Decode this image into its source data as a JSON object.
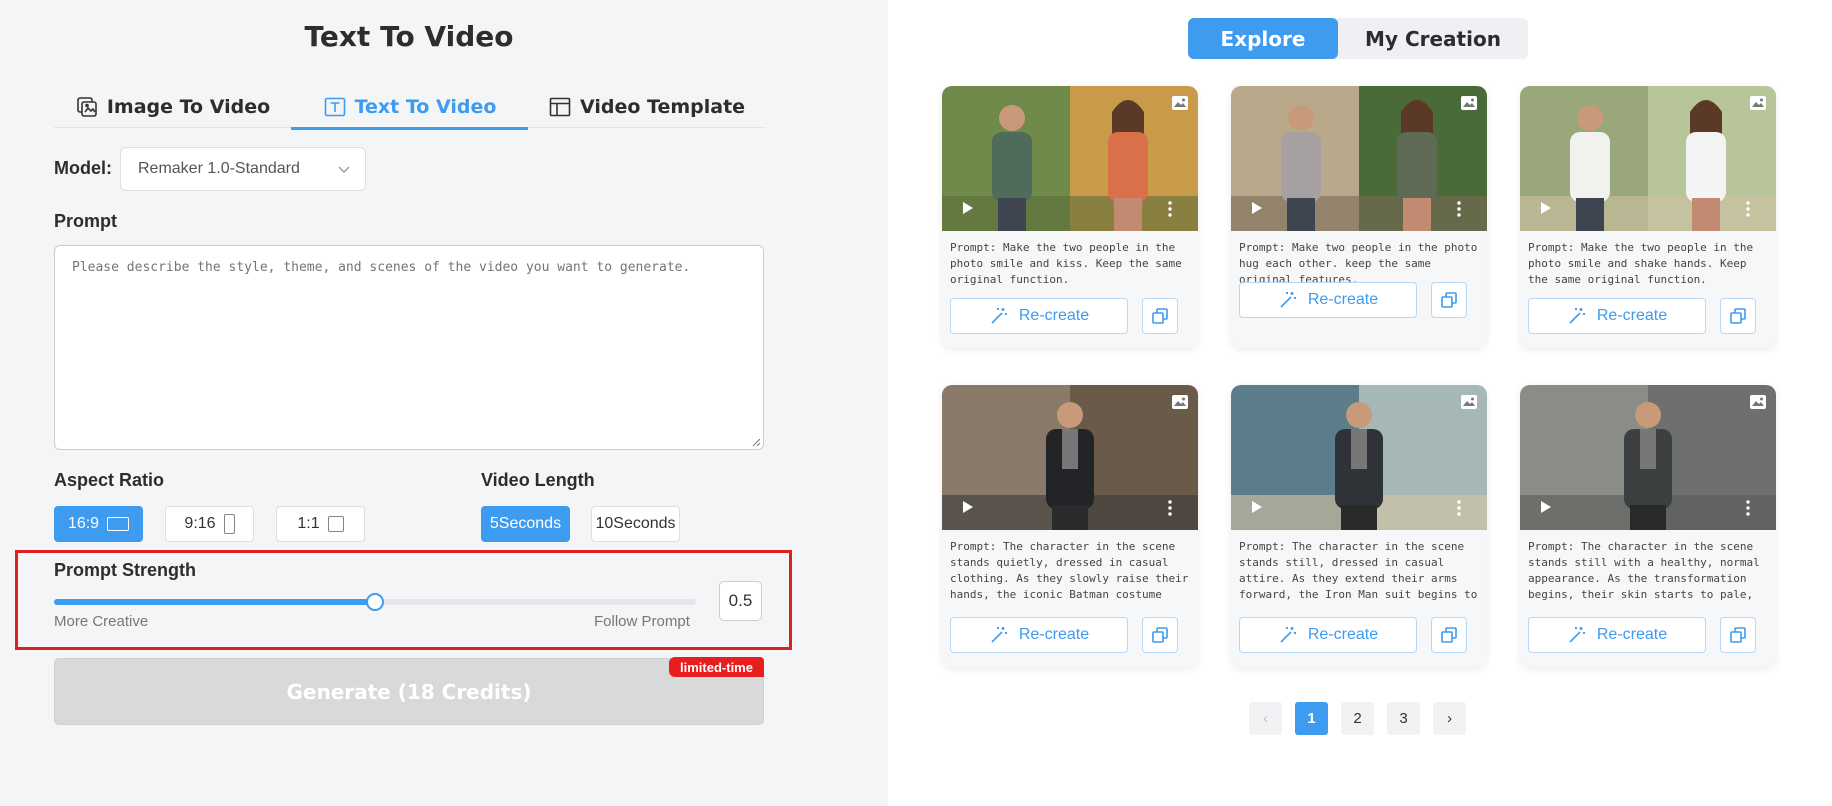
{
  "left": {
    "title": "Text To Video",
    "tabs": [
      {
        "label": "Image To Video",
        "icon": "image-to-video-icon"
      },
      {
        "label": "Text To Video",
        "icon": "text-icon",
        "active": true
      },
      {
        "label": "Video Template",
        "icon": "template-icon"
      }
    ],
    "model": {
      "label": "Model:",
      "value": "Remaker 1.0-Standard"
    },
    "prompt": {
      "label": "Prompt",
      "placeholder": "Please describe the style, theme, and scenes of the video you want to generate."
    },
    "aspect_ratio": {
      "label": "Aspect Ratio",
      "options": [
        {
          "label": "16:9",
          "active": true
        },
        {
          "label": "9:16"
        },
        {
          "label": "1:1"
        }
      ]
    },
    "video_length": {
      "label": "Video Length",
      "options": [
        {
          "label": "5Seconds",
          "active": true
        },
        {
          "label": "10Seconds"
        }
      ]
    },
    "prompt_strength": {
      "label": "Prompt Strength",
      "min_label": "More Creative",
      "max_label": "Follow Prompt",
      "value_text": "0.5",
      "value": 0.5
    },
    "generate": {
      "label": "Generate (18 Credits)",
      "badge": "limited-time"
    }
  },
  "right": {
    "switch": {
      "explore": "Explore",
      "my_creation": "My Creation"
    },
    "recreate_label": "Re-create",
    "cards": [
      {
        "prompt": "Prompt: Make the two people in the photo smile and kiss. Keep the same original function."
      },
      {
        "prompt": "Prompt: Make two people in the photo hug each other. keep the same original features."
      },
      {
        "prompt": "Prompt: Make the two people in the photo smile and shake hands. Keep the same original function."
      },
      {
        "prompt": "Prompt: The character in the scene stands quietly, dressed in casual clothing. As they slowly raise their hands, the iconic Batman costume begins to form around their body. Th..."
      },
      {
        "prompt": "Prompt: The character in the scene stands still, dressed in casual attire. As they extend their arms forward, the Iron Man suit begins to materialize around them. The transformation..."
      },
      {
        "prompt": "Prompt: The character in the scene stands still with a healthy, normal appearance. As the transformation begins, their skin starts to pale, and veins appear dark and prominent..."
      }
    ],
    "pagination": {
      "prev": "‹",
      "pages": [
        "1",
        "2",
        "3"
      ],
      "next": "›"
    }
  },
  "colors": {
    "accent": "#3d9bf0",
    "badge": "#e81e1e",
    "highlight": "#e02020"
  }
}
